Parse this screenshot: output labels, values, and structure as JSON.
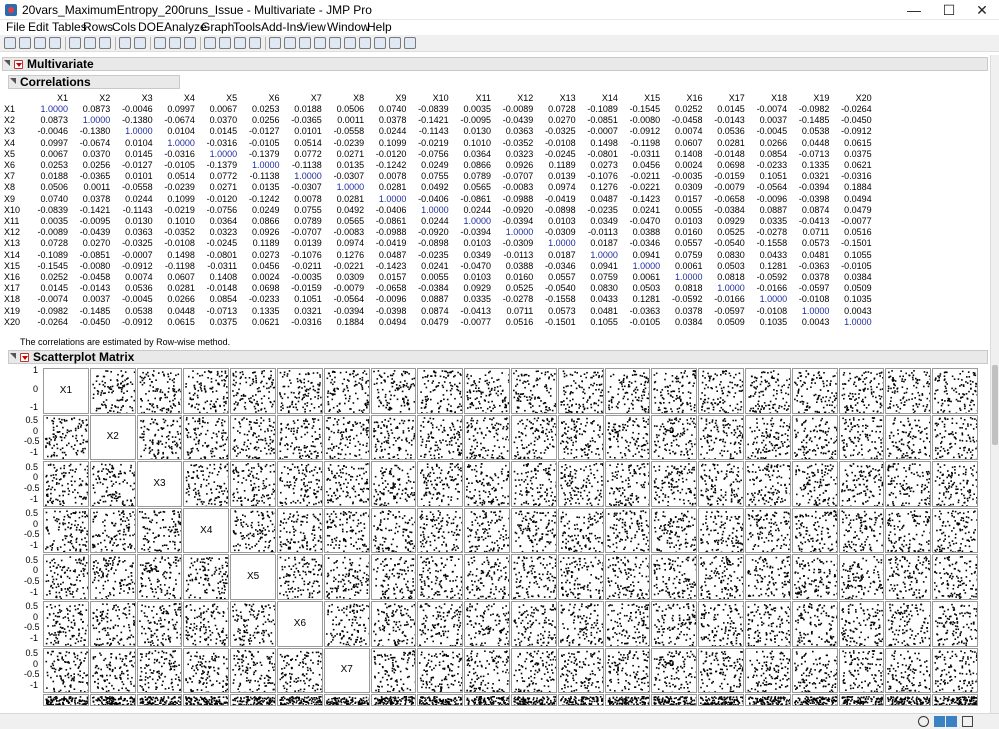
{
  "window": {
    "title": "20vars_MaximumEntropy_200runs_Issue - Multivariate - JMP Pro",
    "min_glyph": "—",
    "max_glyph": "☐",
    "close_glyph": "✕"
  },
  "menu": [
    "File",
    "Edit",
    "Tables",
    "Rows",
    "Cols",
    "DOE",
    "Analyze",
    "Graph",
    "Tools",
    "Add-Ins",
    "View",
    "Window",
    "Help"
  ],
  "toolbar_icons": [
    "new-table-icon",
    "new-script-icon",
    "open-icon",
    "save-icon",
    "cut-icon",
    "copy-icon",
    "paste-icon",
    "script-icon",
    "lock-icon",
    "table-icon",
    "data-grid-icon",
    "run-icon",
    "arrow-icon",
    "help-icon",
    "crosshair-icon",
    "move-icon",
    "hand-icon",
    "lasso-icon",
    "brush-icon",
    "zoom-icon",
    "cross-icon",
    "line-icon",
    "text-icon",
    "note-icon",
    "simple-shape-icon",
    "oval-icon"
  ],
  "outline": {
    "multivariate": "Multivariate",
    "correlations": "Correlations",
    "scatterplot": "Scatterplot Matrix"
  },
  "correlations": {
    "columns": [
      "X1",
      "X2",
      "X3",
      "X4",
      "X5",
      "X6",
      "X7",
      "X8",
      "X9",
      "X10",
      "X11",
      "X12",
      "X13",
      "X14",
      "X15",
      "X16",
      "X17",
      "X18",
      "X19",
      "X20"
    ],
    "rows": [
      [
        "X1",
        [
          "1.0000",
          "0.0873",
          "-0.0046",
          "0.0997",
          "0.0067",
          "0.0253",
          "0.0188",
          "0.0506",
          "0.0740",
          "-0.0839",
          "0.0035",
          "-0.0089",
          "0.0728",
          "-0.1089",
          "-0.1545",
          "0.0252",
          "0.0145",
          "-0.0074",
          "-0.0982",
          "-0.0264"
        ]
      ],
      [
        "X2",
        [
          "0.0873",
          "1.0000",
          "-0.1380",
          "-0.0674",
          "0.0370",
          "0.0256",
          "-0.0365",
          "0.0011",
          "0.0378",
          "-0.1421",
          "-0.0095",
          "-0.0439",
          "0.0270",
          "-0.0851",
          "-0.0080",
          "-0.0458",
          "-0.0143",
          "0.0037",
          "-0.1485",
          "-0.0450"
        ]
      ],
      [
        "X3",
        [
          "-0.0046",
          "-0.1380",
          "1.0000",
          "0.0104",
          "0.0145",
          "-0.0127",
          "0.0101",
          "-0.0558",
          "0.0244",
          "-0.1143",
          "0.0130",
          "0.0363",
          "-0.0325",
          "-0.0007",
          "-0.0912",
          "0.0074",
          "0.0536",
          "-0.0045",
          "0.0538",
          "-0.0912"
        ]
      ],
      [
        "X4",
        [
          "0.0997",
          "-0.0674",
          "0.0104",
          "1.0000",
          "-0.0316",
          "-0.0105",
          "0.0514",
          "-0.0239",
          "0.1099",
          "-0.0219",
          "0.1010",
          "-0.0352",
          "-0.0108",
          "0.1498",
          "-0.1198",
          "0.0607",
          "0.0281",
          "0.0266",
          "0.0448",
          "0.0615"
        ]
      ],
      [
        "X5",
        [
          "0.0067",
          "0.0370",
          "0.0145",
          "-0.0316",
          "1.0000",
          "-0.1379",
          "0.0772",
          "0.0271",
          "-0.0120",
          "-0.0756",
          "0.0364",
          "0.0323",
          "-0.0245",
          "-0.0801",
          "-0.0311",
          "0.1408",
          "-0.0148",
          "0.0854",
          "-0.0713",
          "0.0375"
        ]
      ],
      [
        "X6",
        [
          "0.0253",
          "0.0256",
          "-0.0127",
          "-0.0105",
          "-0.1379",
          "1.0000",
          "-0.1138",
          "0.0135",
          "-0.1242",
          "0.0249",
          "0.0866",
          "0.0926",
          "0.1189",
          "0.0273",
          "0.0456",
          "0.0024",
          "0.0698",
          "-0.0233",
          "0.1335",
          "0.0621"
        ]
      ],
      [
        "X7",
        [
          "0.0188",
          "-0.0365",
          "0.0101",
          "0.0514",
          "0.0772",
          "-0.1138",
          "1.0000",
          "-0.0307",
          "0.0078",
          "0.0755",
          "0.0789",
          "-0.0707",
          "0.0139",
          "-0.1076",
          "-0.0211",
          "-0.0035",
          "-0.0159",
          "0.1051",
          "0.0321",
          "-0.0316"
        ]
      ],
      [
        "X8",
        [
          "0.0506",
          "0.0011",
          "-0.0558",
          "-0.0239",
          "0.0271",
          "0.0135",
          "-0.0307",
          "1.0000",
          "0.0281",
          "0.0492",
          "0.0565",
          "-0.0083",
          "0.0974",
          "0.1276",
          "-0.0221",
          "0.0309",
          "-0.0079",
          "-0.0564",
          "-0.0394",
          "0.1884"
        ]
      ],
      [
        "X9",
        [
          "0.0740",
          "0.0378",
          "0.0244",
          "0.1099",
          "-0.0120",
          "-0.1242",
          "0.0078",
          "0.0281",
          "1.0000",
          "-0.0406",
          "-0.0861",
          "-0.0988",
          "-0.0419",
          "0.0487",
          "-0.1423",
          "0.0157",
          "-0.0658",
          "-0.0096",
          "-0.0398",
          "0.0494"
        ]
      ],
      [
        "X10",
        [
          "-0.0839",
          "-0.1421",
          "-0.1143",
          "-0.0219",
          "-0.0756",
          "0.0249",
          "0.0755",
          "0.0492",
          "-0.0406",
          "1.0000",
          "0.0244",
          "-0.0920",
          "-0.0898",
          "-0.0235",
          "0.0241",
          "0.0055",
          "-0.0384",
          "0.0887",
          "0.0874",
          "0.0479"
        ]
      ],
      [
        "X11",
        [
          "0.0035",
          "-0.0095",
          "0.0130",
          "0.1010",
          "0.0364",
          "0.0866",
          "0.0789",
          "0.0565",
          "-0.0861",
          "0.0244",
          "1.0000",
          "-0.0394",
          "0.0103",
          "0.0349",
          "-0.0470",
          "0.0103",
          "0.0929",
          "0.0335",
          "-0.0413",
          "-0.0077"
        ]
      ],
      [
        "X12",
        [
          "-0.0089",
          "-0.0439",
          "0.0363",
          "-0.0352",
          "0.0323",
          "0.0926",
          "-0.0707",
          "-0.0083",
          "-0.0988",
          "-0.0920",
          "-0.0394",
          "1.0000",
          "-0.0309",
          "-0.0113",
          "0.0388",
          "0.0160",
          "0.0525",
          "-0.0278",
          "0.0711",
          "0.0516"
        ]
      ],
      [
        "X13",
        [
          "0.0728",
          "0.0270",
          "-0.0325",
          "-0.0108",
          "-0.0245",
          "0.1189",
          "0.0139",
          "0.0974",
          "-0.0419",
          "-0.0898",
          "0.0103",
          "-0.0309",
          "1.0000",
          "0.0187",
          "-0.0346",
          "0.0557",
          "-0.0540",
          "-0.1558",
          "0.0573",
          "-0.1501"
        ]
      ],
      [
        "X14",
        [
          "-0.1089",
          "-0.0851",
          "-0.0007",
          "0.1498",
          "-0.0801",
          "0.0273",
          "-0.1076",
          "0.1276",
          "0.0487",
          "-0.0235",
          "0.0349",
          "-0.0113",
          "0.0187",
          "1.0000",
          "0.0941",
          "0.0759",
          "0.0830",
          "0.0433",
          "0.0481",
          "0.1055"
        ]
      ],
      [
        "X15",
        [
          "-0.1545",
          "-0.0080",
          "-0.0912",
          "-0.1198",
          "-0.0311",
          "0.0456",
          "-0.0211",
          "-0.0221",
          "-0.1423",
          "0.0241",
          "-0.0470",
          "0.0388",
          "-0.0346",
          "0.0941",
          "1.0000",
          "0.0061",
          "0.0503",
          "0.1281",
          "-0.0363",
          "-0.0105"
        ]
      ],
      [
        "X16",
        [
          "0.0252",
          "-0.0458",
          "0.0074",
          "0.0607",
          "0.1408",
          "0.0024",
          "-0.0035",
          "0.0309",
          "0.0157",
          "0.0055",
          "0.0103",
          "0.0160",
          "0.0557",
          "0.0759",
          "0.0061",
          "1.0000",
          "0.0818",
          "-0.0592",
          "0.0378",
          "0.0384"
        ]
      ],
      [
        "X17",
        [
          "0.0145",
          "-0.0143",
          "0.0536",
          "0.0281",
          "-0.0148",
          "0.0698",
          "-0.0159",
          "-0.0079",
          "-0.0658",
          "-0.0384",
          "0.0929",
          "0.0525",
          "-0.0540",
          "0.0830",
          "0.0503",
          "0.0818",
          "1.0000",
          "-0.0166",
          "-0.0597",
          "0.0509"
        ]
      ],
      [
        "X18",
        [
          "-0.0074",
          "0.0037",
          "-0.0045",
          "0.0266",
          "0.0854",
          "-0.0233",
          "0.1051",
          "-0.0564",
          "-0.0096",
          "0.0887",
          "0.0335",
          "-0.0278",
          "-0.1558",
          "0.0433",
          "0.1281",
          "-0.0592",
          "-0.0166",
          "1.0000",
          "-0.0108",
          "0.1035"
        ]
      ],
      [
        "X19",
        [
          "-0.0982",
          "-0.1485",
          "0.0538",
          "0.0448",
          "-0.0713",
          "0.1335",
          "0.0321",
          "-0.0394",
          "-0.0398",
          "0.0874",
          "-0.0413",
          "0.0711",
          "0.0573",
          "0.0481",
          "-0.0363",
          "0.0378",
          "-0.0597",
          "-0.0108",
          "1.0000",
          "0.0043"
        ]
      ],
      [
        "X20",
        [
          "-0.0264",
          "-0.0450",
          "-0.0912",
          "0.0615",
          "0.0375",
          "0.0621",
          "-0.0316",
          "0.1884",
          "0.0494",
          "0.0479",
          "-0.0077",
          "0.0516",
          "-0.1501",
          "0.1055",
          "-0.0105",
          "0.0384",
          "0.0509",
          "0.1035",
          "0.0043",
          "1.0000"
        ]
      ]
    ]
  },
  "note": "The correlations are estimated by Row-wise method.",
  "scatter": {
    "diag_labels": [
      "X1",
      "X2",
      "X3",
      "X4",
      "X5",
      "X6",
      "X7"
    ],
    "first_row_ticks": [
      "1",
      "0",
      "-1"
    ],
    "row_ticks": [
      "0.5",
      "0",
      "-0.5",
      "-1"
    ]
  },
  "colors": {
    "accent_red": "#cc0000",
    "diag_blue": "#1e2ca0",
    "header_gray": "#e9e9e9"
  }
}
